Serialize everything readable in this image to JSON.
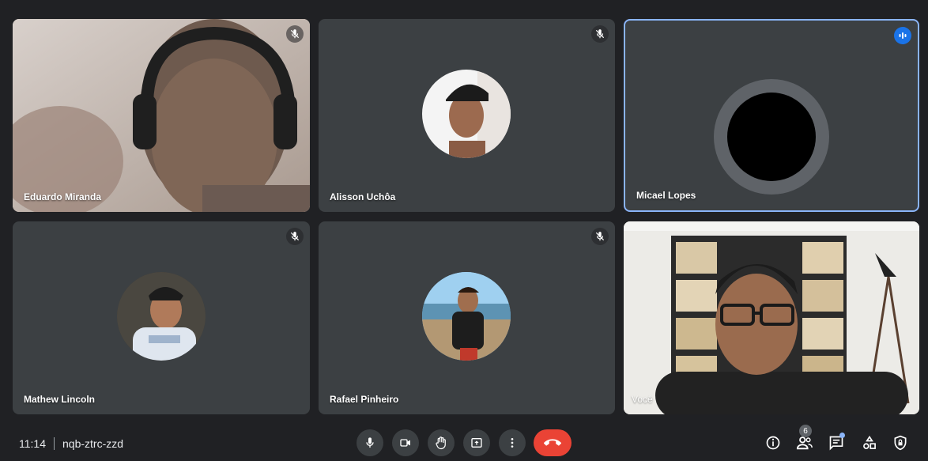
{
  "participants": [
    {
      "name": "Eduardo Miranda"
    },
    {
      "name": "Alisson Uchôa"
    },
    {
      "name": "Micael Lopes"
    },
    {
      "name": "Mathew Lincoln"
    },
    {
      "name": "Rafael Pinheiro"
    },
    {
      "name": "Você"
    }
  ],
  "meeting": {
    "time": "11:14",
    "code": "nqb-ztrc-zzd"
  },
  "people_count": "6",
  "colors": {
    "background": "#202124",
    "tile": "#3c4043",
    "active_border": "#8ab4f8",
    "speaking": "#1a73e8",
    "hangup": "#ea4335"
  },
  "icons": {
    "controls": [
      "mic-icon",
      "camera-icon",
      "raise-hand-icon",
      "present-icon",
      "more-options-icon",
      "hangup-icon"
    ],
    "right": [
      "info-icon",
      "people-icon",
      "chat-icon",
      "activities-icon",
      "host-controls-icon"
    ]
  }
}
